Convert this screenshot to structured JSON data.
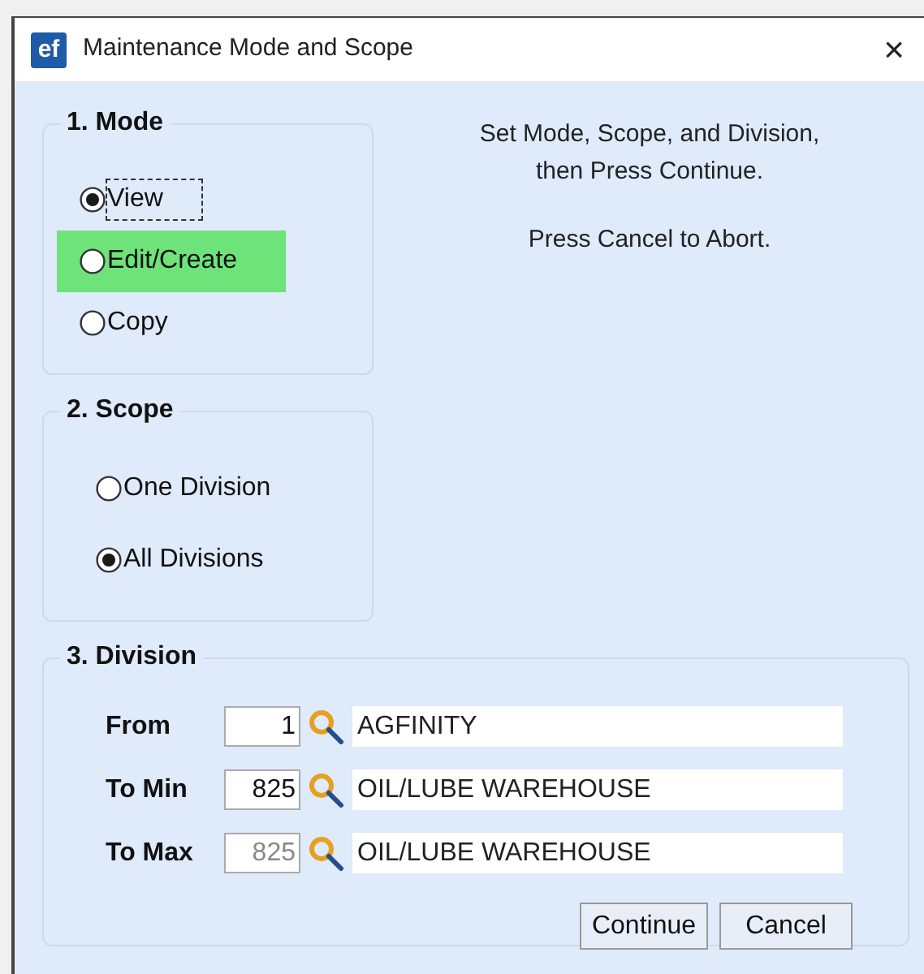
{
  "window": {
    "title": "Maintenance Mode and Scope",
    "logo": "ef",
    "close": "×"
  },
  "mode": {
    "title": "1. Mode",
    "options": [
      {
        "label": "View",
        "selected": true,
        "focused": true,
        "highlighted": false
      },
      {
        "label": "Edit/Create",
        "selected": false,
        "focused": false,
        "highlighted": true
      },
      {
        "label": "Copy",
        "selected": false,
        "focused": false,
        "highlighted": false
      }
    ]
  },
  "instructions": [
    "Set Mode, Scope, and Division,",
    "then Press Continue.",
    "Press Cancel to Abort."
  ],
  "scope": {
    "title": "2. Scope",
    "options": [
      {
        "label": "One Division",
        "selected": false
      },
      {
        "label": "All Divisions",
        "selected": true
      }
    ]
  },
  "division": {
    "title": "3. Division",
    "rows": [
      {
        "label": "From",
        "value": "1",
        "description": "AGFINITY",
        "disabled": false
      },
      {
        "label": "To Min",
        "value": "825",
        "description": "OIL/LUBE WAREHOUSE",
        "disabled": false
      },
      {
        "label": "To Max",
        "value": "825",
        "description": "OIL/LUBE WAREHOUSE",
        "disabled": true
      }
    ]
  },
  "buttons": [
    {
      "label": "Continue"
    },
    {
      "label": "Cancel"
    }
  ]
}
